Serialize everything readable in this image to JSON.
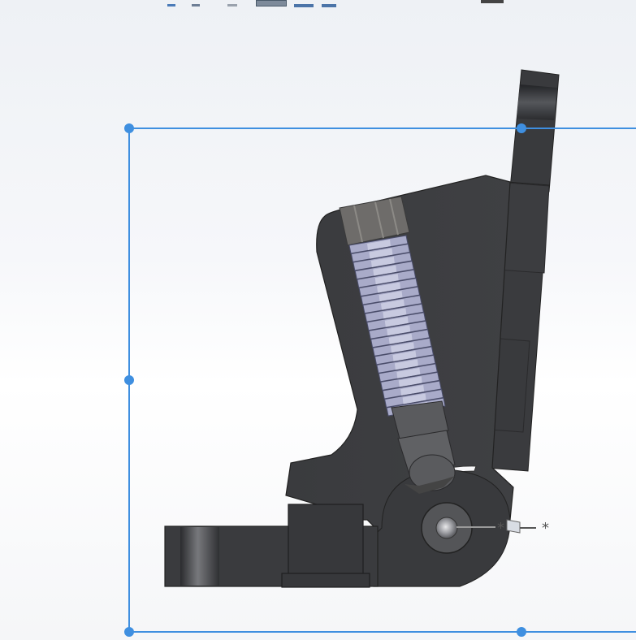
{
  "app": {
    "kind": "cad-viewport",
    "toolbar_icons": [
      "view-orientation-icon",
      "display-style-icon",
      "section-view-icon",
      "hide-show-icon",
      "appearance-icon",
      "scene-icon",
      "view-settings-icon"
    ]
  },
  "viewport": {
    "background": "#f2f4f7",
    "selection_color": "#3f8fe0",
    "part_color": "#3c3d40",
    "spring_color": "#a9abc9",
    "handle_count": 6
  },
  "model": {
    "description_hidden": true,
    "parts": [
      "main-body",
      "hinge-pivot",
      "spring-assembly",
      "plunger",
      "base-bracket",
      "clamp-block",
      "upper-lever"
    ]
  },
  "triad": {
    "axis_symbol": "*"
  }
}
